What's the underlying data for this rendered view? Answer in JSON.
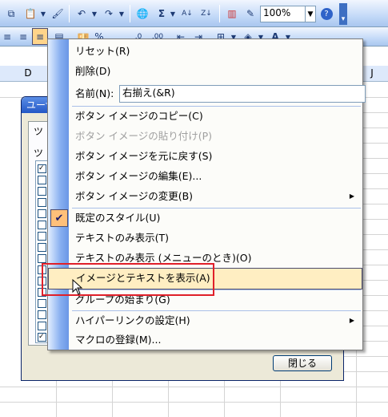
{
  "toolbar1": {
    "zoom_value": "100%"
  },
  "toolbar2": {
    "percent_label": "%"
  },
  "sheet": {
    "col_d": "D",
    "col_j": "J"
  },
  "dialog": {
    "title_fragment": "ユーザ",
    "tab_fragment": "ツ",
    "list_fragment": "ツ",
    "close_label": "閉じる"
  },
  "menu": {
    "items": [
      {
        "label": "リセット(R)"
      },
      {
        "label": "削除(D)"
      },
      {
        "label": "名前(N):"
      },
      {
        "label": "ボタン イメージのコピー(C)"
      },
      {
        "label": "ボタン イメージの貼り付け(P)"
      },
      {
        "label": "ボタン イメージを元に戻す(S)"
      },
      {
        "label": "ボタン イメージの編集(E)..."
      },
      {
        "label": "ボタン イメージの変更(B)"
      },
      {
        "label": "既定のスタイル(U)"
      },
      {
        "label": "テキストのみ表示(T)"
      },
      {
        "label": "テキストのみ表示 (メニューのとき)(O)"
      },
      {
        "label": "イメージとテキストを表示(A)"
      },
      {
        "label": "グループの始まり(G)"
      },
      {
        "label": "ハイパーリンクの設定(H)"
      },
      {
        "label": "マクロの登録(M)..."
      }
    ],
    "name_value": "右揃え(&R)"
  }
}
